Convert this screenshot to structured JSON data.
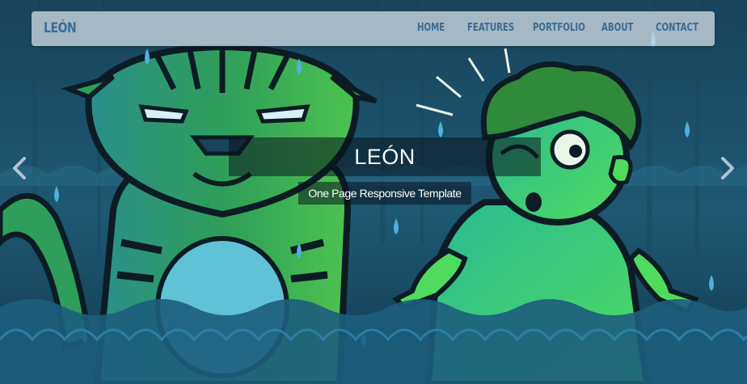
{
  "brand": {
    "name": "LEÓN"
  },
  "nav": {
    "items": [
      {
        "label": "HOME"
      },
      {
        "label": "FEATURES"
      },
      {
        "label": "PORTFOLIO"
      },
      {
        "label": "ABOUT"
      },
      {
        "label": "CONTACT"
      }
    ]
  },
  "slide": {
    "title": "LEÓN",
    "subtitle": "One Page Responsive Template"
  },
  "carousel": {
    "prev_icon": "chevron-left-icon",
    "next_icon": "chevron-right-icon"
  },
  "colors": {
    "nav_text": "#3b6c95",
    "background": "#1d4f6a",
    "tiger_green": "#2f9e5a",
    "boy_green": "#3ed26a"
  }
}
